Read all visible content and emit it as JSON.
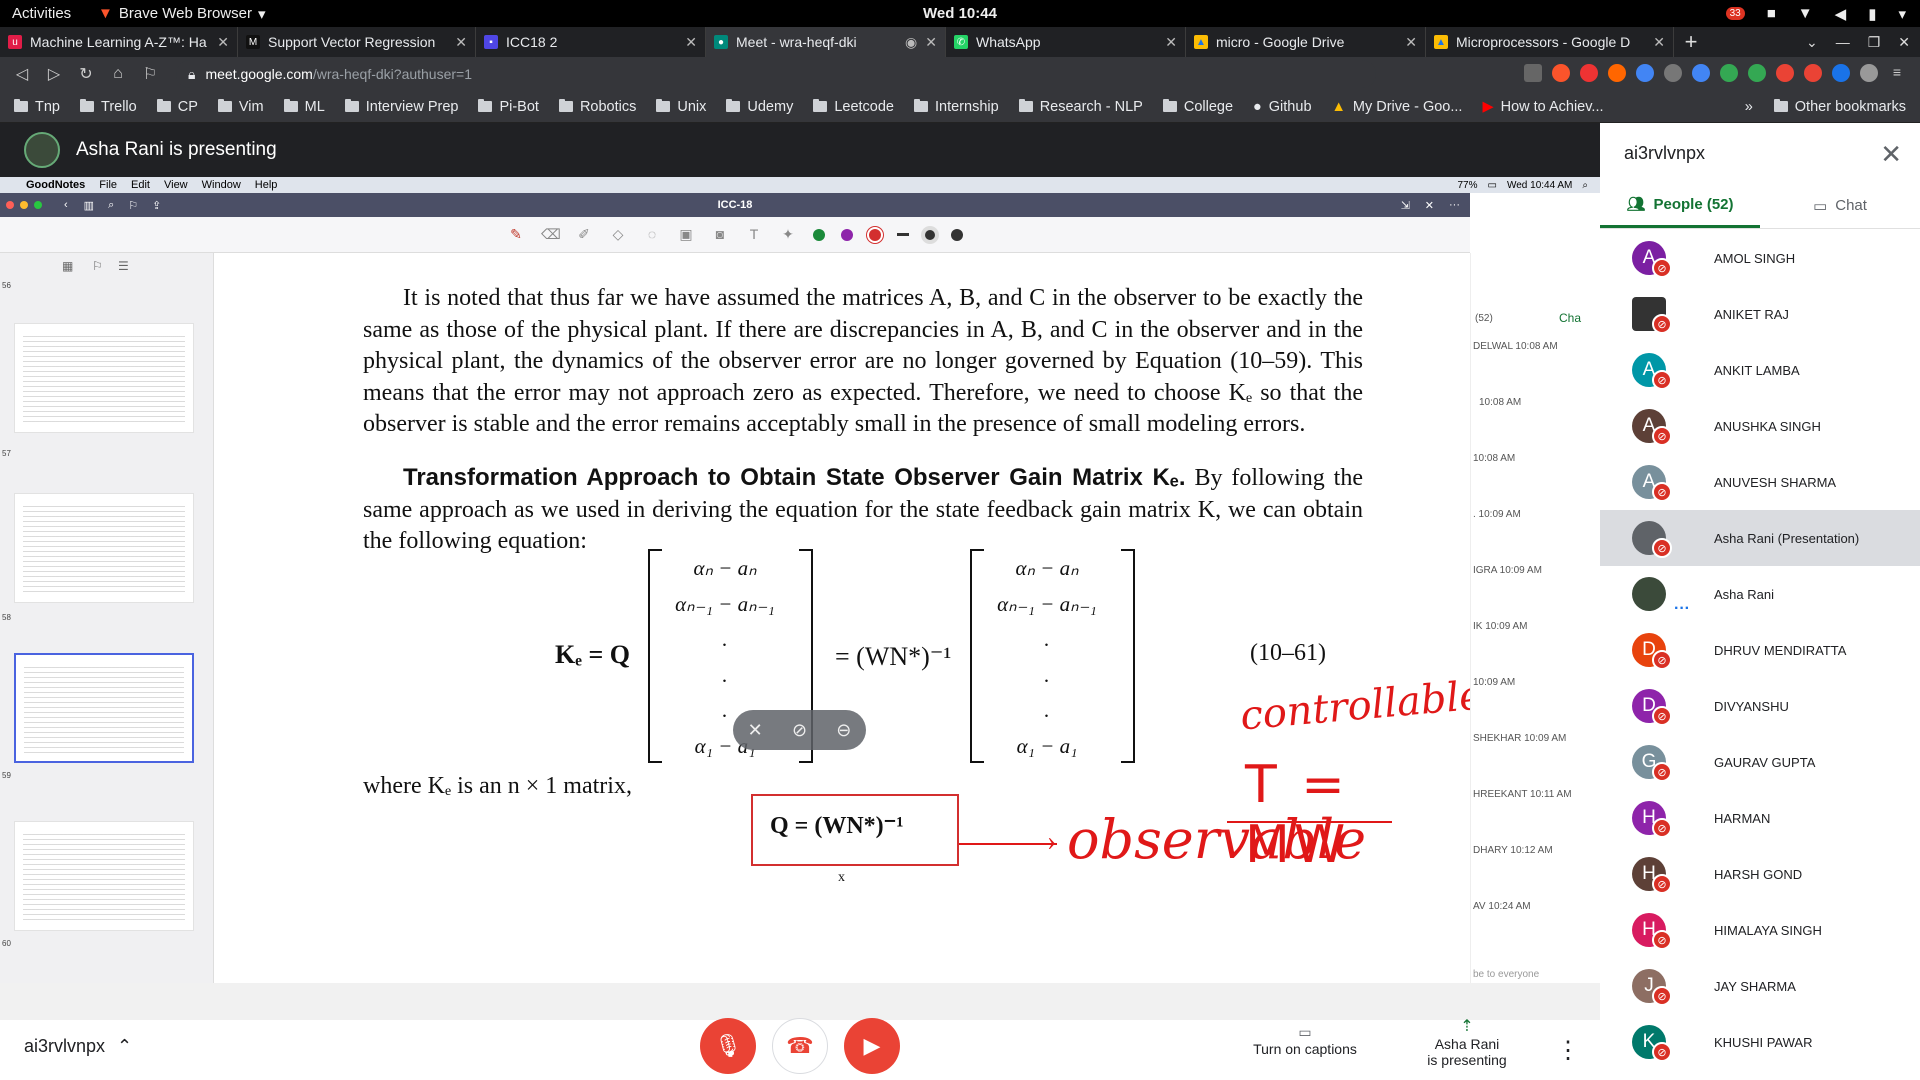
{
  "gnome": {
    "activities": "Activities",
    "app_name": "Brave Web Browser",
    "clock": "Wed 10:44",
    "notif_count": "33"
  },
  "tabs": [
    {
      "title": "Machine Learning A-Z™: Ha",
      "color": "#e11d48",
      "fav": "u"
    },
    {
      "title": "Support Vector Regression",
      "color": "#111111",
      "fav": "M"
    },
    {
      "title": "ICC18 2",
      "color": "#4f46e5",
      "fav": "▪"
    },
    {
      "title": "Meet - wra-heqf-dki",
      "color": "#00897b",
      "fav": "●"
    },
    {
      "title": "WhatsApp",
      "color": "#25d366",
      "fav": "✆"
    },
    {
      "title": "micro - Google Drive",
      "color": "#fbbc04",
      "fav": "▲"
    },
    {
      "title": "Microprocessors - Google D",
      "color": "#fbbc04",
      "fav": "▲"
    }
  ],
  "url": {
    "host": "meet.google.com",
    "path": "/wra-heqf-dki?authuser=1"
  },
  "bookmarks": [
    "Tnp",
    "Trello",
    "CP",
    "Vim",
    "ML",
    "Interview Prep",
    "Pi-Bot",
    "Robotics",
    "Unix",
    "Udemy",
    "Leetcode",
    "Internship",
    "Research - NLP",
    "College",
    "Github",
    "My Drive - Goo...",
    "How to Achiev..."
  ],
  "bookmarks_other": "Other bookmarks",
  "presenting_label": "Asha Rani is presenting",
  "mac": {
    "app": "GoodNotes",
    "menu": [
      "File",
      "Edit",
      "View",
      "Window",
      "Help"
    ],
    "battery": "77%",
    "clock": "Wed 10:44 AM",
    "doc_title": "ICC-18"
  },
  "page_numbers": [
    "56",
    "57",
    "58",
    "59",
    "60"
  ],
  "doc": {
    "para1": "It is noted that thus far we have assumed the matrices A, B, and C in the observer to be exactly the same as those of the physical plant. If there are discrepancies in A, B, and C in the observer and in the physical plant, the dynamics of the observer error are no longer governed by Equation (10–59). This means that the error may not approach zero as expected. Therefore, we need to choose Kₑ so that the observer is stable and the error remains acceptably small in the presence of small modeling errors.",
    "heading": "Transformation Approach to Obtain State Observer Gain Matrix Kₑ.",
    "heading_rest": "By following the same approach as we used in deriving the equation for the state feedback gain matrix K, we can obtain the following equation:",
    "eq_lhs": "Kₑ = Q",
    "eq_mid": "= (WN*)⁻¹",
    "eq_num": "(10–61)",
    "vector_rows": [
      "αₙ − aₙ",
      "αₙ₋₁ − aₙ₋₁",
      ".",
      ".",
      ".",
      "α₁ − a₁"
    ],
    "where": "where Kₑ is an n × 1 matrix,",
    "boxed": "Q = (WN*)⁻¹"
  },
  "annotations": {
    "controllable": "controllable",
    "t_eq": "T = MW",
    "observable": "observable"
  },
  "strip": {
    "people_count": "(52)",
    "chat": "Cha",
    "items": [
      "DELWAL 10:08 AM",
      "10:08 AM",
      "10:08 AM",
      ". 10:09 AM",
      "IGRA 10:09 AM",
      "IK 10:09 AM",
      "10:09 AM",
      "SHEKHAR 10:09 AM",
      "HREEKANT 10:11 AM",
      "DHARY 10:12 AM",
      "AV 10:24 AM"
    ],
    "footer": "be to everyone"
  },
  "sidebar": {
    "meeting_code": "ai3rvlvnpx",
    "people_tab": "People (52)",
    "chat_tab": "Chat",
    "people": [
      {
        "name": "AMOL SINGH",
        "initial": "A",
        "color": "#7b1fa2"
      },
      {
        "name": "ANIKET RAJ",
        "initial": "",
        "color": "#333333"
      },
      {
        "name": "ANKIT LAMBA",
        "initial": "A",
        "color": "#0097a7"
      },
      {
        "name": "ANUSHKA SINGH",
        "initial": "A",
        "color": "#5d4037"
      },
      {
        "name": "ANUVESH SHARMA",
        "initial": "A",
        "color": "#78909c"
      },
      {
        "name": "Asha Rani (Presentation)",
        "initial": "",
        "color": "#5f6368"
      },
      {
        "name": "Asha Rani",
        "initial": "",
        "color": "#3b4a3a"
      },
      {
        "name": "DHRUV MENDIRATTA",
        "initial": "D",
        "color": "#e8430d"
      },
      {
        "name": "DIVYANSHU",
        "initial": "D",
        "color": "#8e24aa"
      },
      {
        "name": "GAURAV GUPTA",
        "initial": "G",
        "color": "#78909c"
      },
      {
        "name": "HARMAN",
        "initial": "H",
        "color": "#8e24aa"
      },
      {
        "name": "HARSH GOND",
        "initial": "H",
        "color": "#5d4037"
      },
      {
        "name": "HIMALAYA SINGH",
        "initial": "H",
        "color": "#d81b60"
      },
      {
        "name": "JAY SHARMA",
        "initial": "J",
        "color": "#8d6e63"
      },
      {
        "name": "KHUSHI PAWAR",
        "initial": "K",
        "color": "#00796b"
      }
    ]
  },
  "controls": {
    "self_name": "ai3rvlvnpx",
    "captions": "Turn on captions",
    "presenting_line1": "Asha Rani",
    "presenting_line2": "is presenting"
  }
}
